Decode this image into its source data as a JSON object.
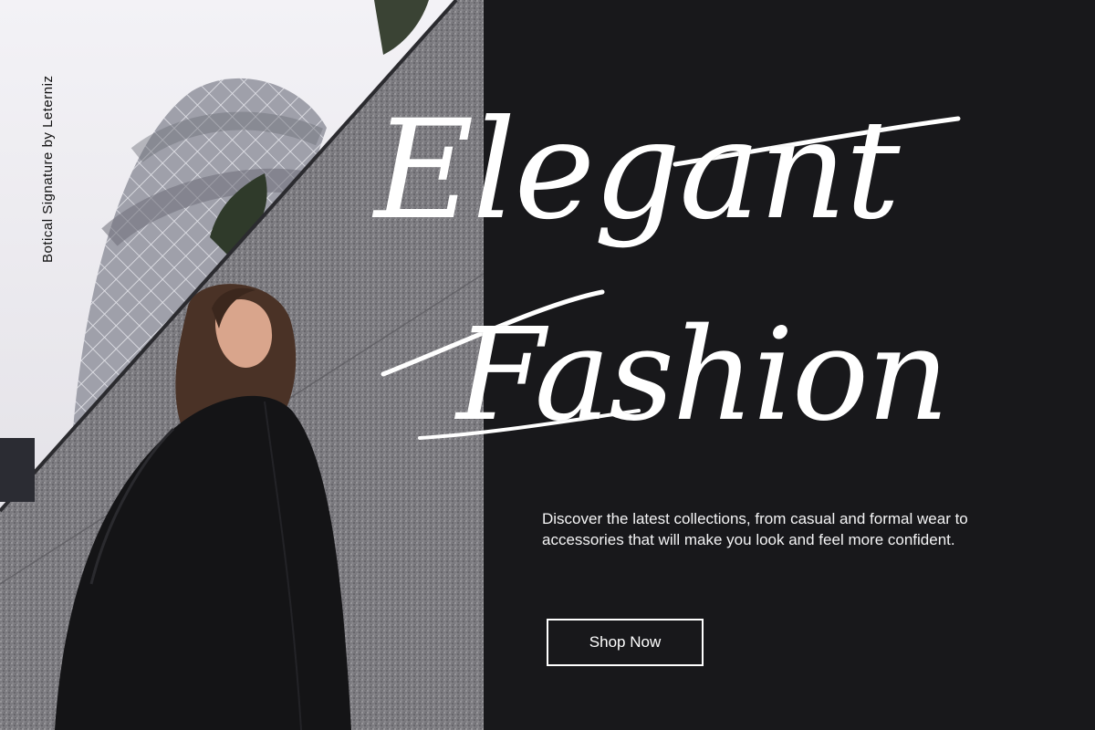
{
  "credit": {
    "text": "Botical Signature by Leterniz"
  },
  "headline": {
    "line1": "Elegant",
    "line2": "Fashion"
  },
  "description": "Discover the latest collections, from casual and formal wear to accessories that will make you look and feel more confident.",
  "cta": {
    "label": "Shop Now"
  },
  "colors": {
    "panel": "#18181b",
    "text": "#ffffff",
    "sky": "#ebe9ee"
  }
}
